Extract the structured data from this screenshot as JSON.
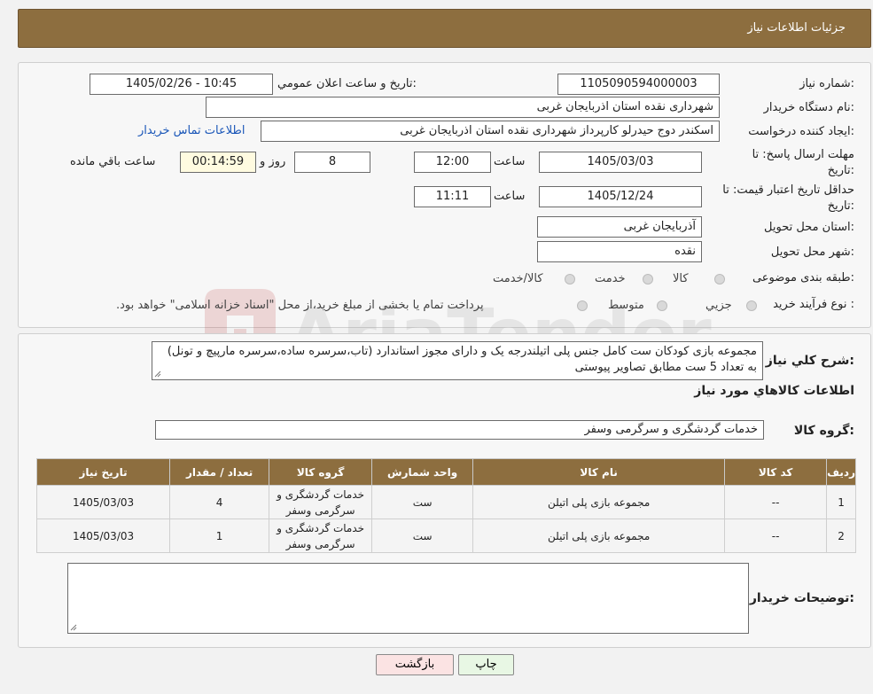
{
  "header": {
    "title": "جزئیات اطلاعات نیاز"
  },
  "form": {
    "need_number_label": "شماره نیاز:",
    "need_number": "1105090594000003",
    "announce_label": "تاریخ و ساعت اعلان عمومي:",
    "announce_value": "1405/02/26 - 10:45",
    "buyer_label": "نام دستگاه خريدار:",
    "buyer_value": "شهرداری نقده استان اذربایجان غربی",
    "creator_label": "ايجاد کننده درخواست:",
    "creator_value": "اسکندر دوج حیدرلو کارپرداز شهرداری نقده استان اذربایجان غربی",
    "contact_link": "اطلاعات تماس خريدار",
    "deadline_label_1": "مهلت ارسال پاسخ: تا",
    "deadline_label_2": "تاریخ:",
    "deadline_date": "1405/03/03",
    "time_label": "ساعت",
    "deadline_time": "12:00",
    "days_value": "8",
    "days_label": "روز و",
    "remaining_value": "00:14:59",
    "remaining_label": "ساعت باقي مانده",
    "validity_label_1": "حداقل تاريخ اعتبار قيمت: تا",
    "validity_label_2": "تاريخ:",
    "validity_date": "1405/12/24",
    "validity_time": "11:11",
    "province_label": "استان محل تحويل:",
    "province_value": "آذربایجان غربی",
    "city_label": "شهر محل تحويل:",
    "city_value": "نقده",
    "category_label": "طبقه بندی موضوعی:",
    "category_options": [
      "کالا",
      "خدمت",
      "کالا/خدمت"
    ],
    "process_label": "نوع فرآيند خريد :",
    "process_options": [
      "جزيي",
      "متوسط"
    ],
    "process_note": "پرداخت تمام يا بخشی از مبلغ خريد،از محل \"اسناد خزانه اسلامی\" خواهد بود."
  },
  "details": {
    "summary_label": "شرح کلي نياز:",
    "summary_text": "مجموعه بازی کودکان ست کامل جنس پلی اتیلندرجه یک و دارای مجوز استاندارد (تاب،سرسره ساده،سرسره مارپیچ و تونل) به تعداد 5 ست مطابق تصاویر پیوستی",
    "goods_info_title": "اطلاعات کالاهاي مورد نياز",
    "goods_group_label": "گروه کالا:",
    "goods_group_value": "خدمات گردشگری و سرگرمی وسفر",
    "table": {
      "headers": [
        "رديف",
        "کد کالا",
        "نام کالا",
        "واحد شمارش",
        "گروه کالا",
        "تعداد / مقدار",
        "تاريخ نياز"
      ],
      "rows": [
        [
          "1",
          "--",
          "مجموعه بازی پلی اتیلن",
          "ست",
          "خدمات گردشگری و سرگرمی وسفر",
          "4",
          "1405/03/03"
        ],
        [
          "2",
          "--",
          "مجموعه بازی پلی اتیلن",
          "ست",
          "خدمات گردشگری و سرگرمی وسفر",
          "1",
          "1405/03/03"
        ]
      ]
    },
    "buyer_notes_label": "توضيحات خريدار:",
    "buyer_notes_value": ""
  },
  "buttons": {
    "print": "چاپ",
    "back": "بازگشت"
  },
  "colors": {
    "header_bg": "#8d6e3f",
    "link": "#1a56b8"
  }
}
